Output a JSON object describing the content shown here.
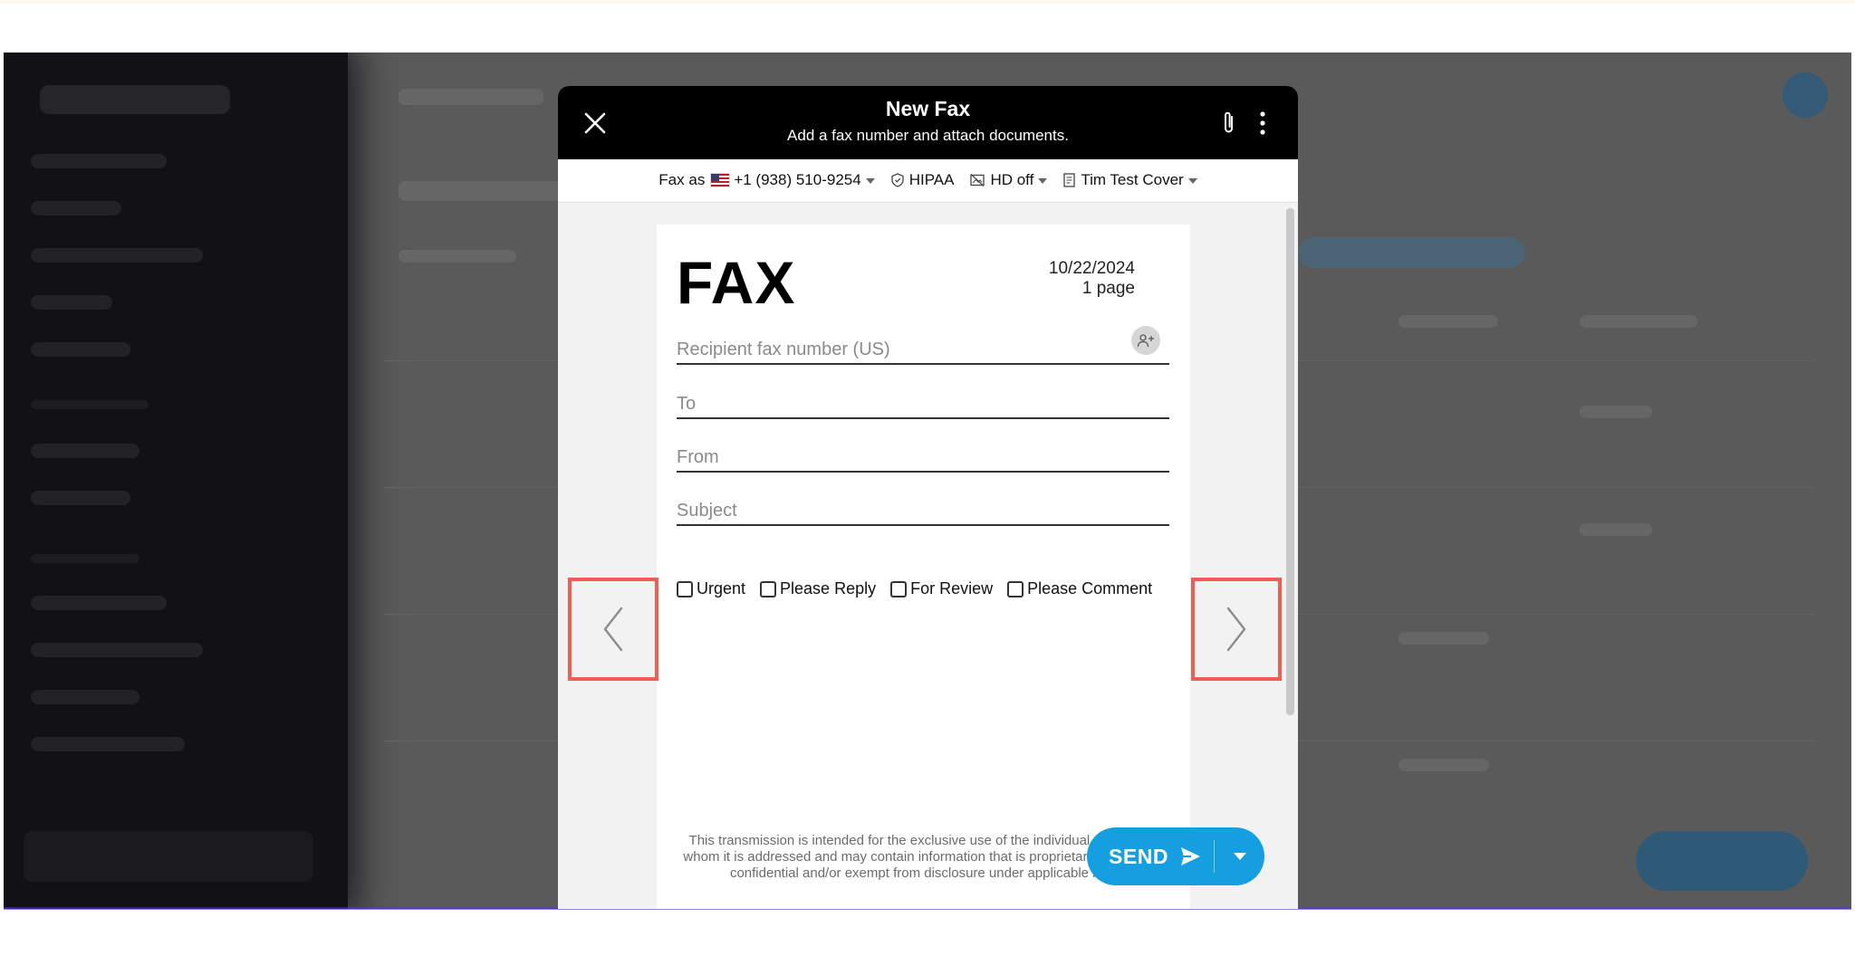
{
  "modal": {
    "title": "New Fax",
    "subtitle": "Add a fax number and attach documents."
  },
  "toolbar": {
    "fax_as_label": "Fax as",
    "fax_number": "+1 (938) 510-9254",
    "hipaa": "HIPAA",
    "hd": "HD off",
    "cover": "Tim Test Cover"
  },
  "cover": {
    "title": "FAX",
    "date": "10/22/2024",
    "pages": "1 page",
    "fields": {
      "recipient_placeholder": "Recipient fax number (US)",
      "to_placeholder": "To",
      "from_placeholder": "From",
      "subject_placeholder": "Subject"
    },
    "checkboxes": [
      "Urgent",
      "Please Reply",
      "For Review",
      "Please Comment"
    ],
    "disclaimer": "This transmission is intended for the exclusive use of the individual or entity to whom it is addressed and may contain information that is proprietary, privileged, confidential and/or exempt from disclosure under applicable law."
  },
  "send": {
    "label": "SEND"
  },
  "icons": {
    "close": "close-icon",
    "attach": "paperclip-icon",
    "more": "more-vertical-icon",
    "flag": "us-flag-icon",
    "hipaa": "shield-icon",
    "hd": "image-off-icon",
    "cover": "document-icon",
    "add_contact": "add-contact-icon",
    "prev": "chevron-left-icon",
    "next": "chevron-right-icon",
    "send": "send-arrow-icon",
    "send_menu": "caret-down-icon"
  },
  "colors": {
    "header_bg": "#000000",
    "send_button": "#169fe0",
    "highlight_box": "#ef5d55"
  }
}
